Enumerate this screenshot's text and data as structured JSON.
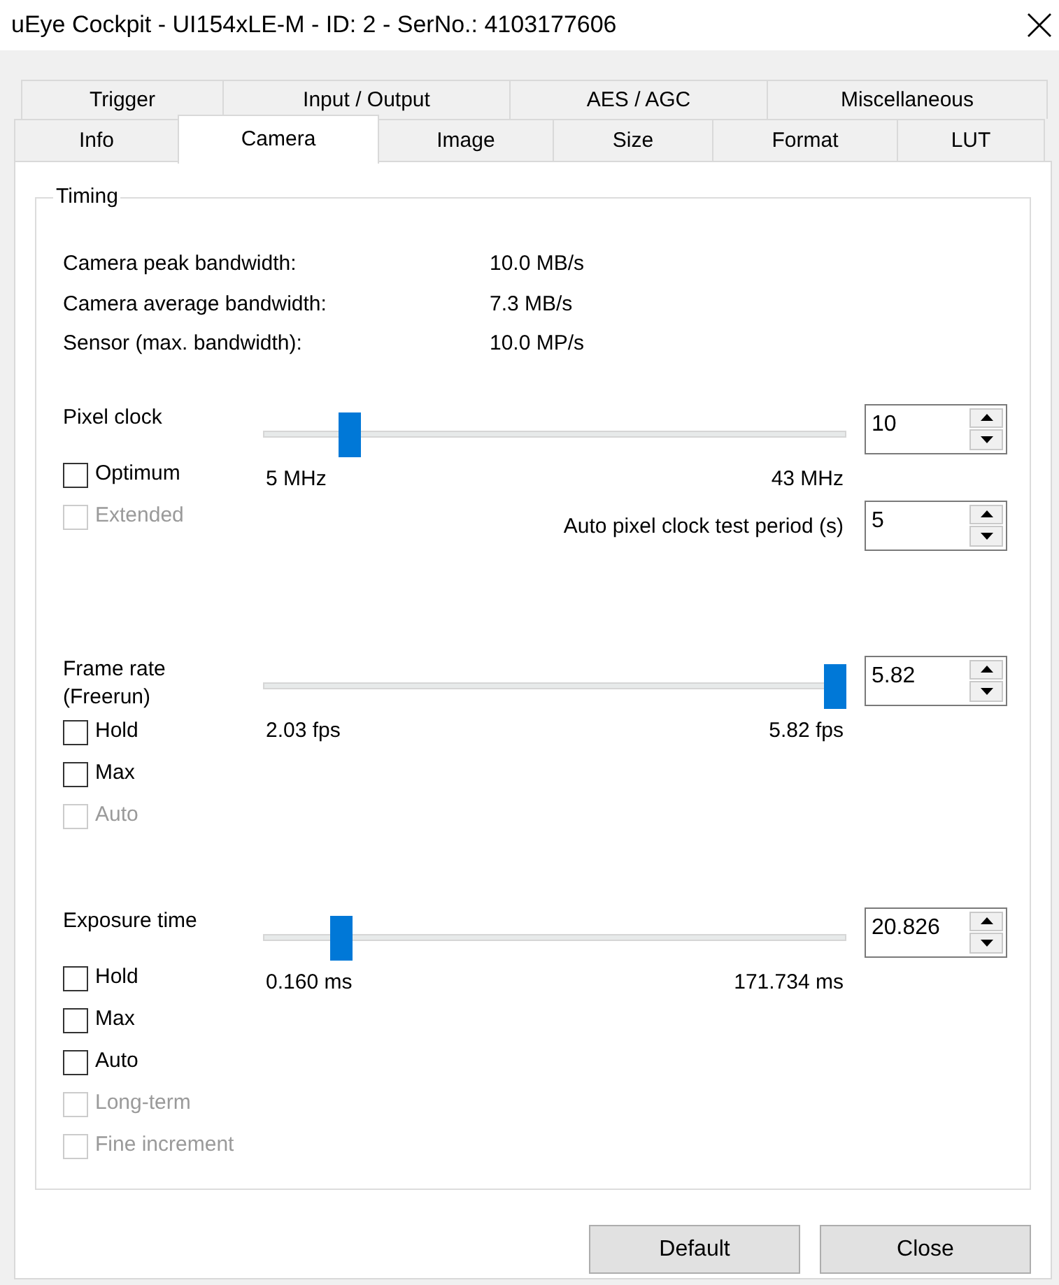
{
  "window": {
    "title": "uEye Cockpit - UI154xLE-M - ID: 2 - SerNo.: 4103177606"
  },
  "tab_rows": [
    [
      {
        "label": "Trigger",
        "selected": false
      },
      {
        "label": "Input / Output",
        "selected": false
      },
      {
        "label": "AES / AGC",
        "selected": false
      },
      {
        "label": "Miscellaneous",
        "selected": false
      }
    ],
    [
      {
        "label": "Info",
        "selected": false
      },
      {
        "label": "Camera",
        "selected": true
      },
      {
        "label": "Image",
        "selected": false
      },
      {
        "label": "Size",
        "selected": false
      },
      {
        "label": "Format",
        "selected": false
      },
      {
        "label": "LUT",
        "selected": false
      }
    ]
  ],
  "group": {
    "title": "Timing",
    "info": [
      {
        "label": "Camera peak bandwidth:",
        "value": "10.0 MB/s"
      },
      {
        "label": "Camera average bandwidth:",
        "value": "7.3 MB/s"
      },
      {
        "label": "Sensor (max. bandwidth):",
        "value": "10.0 MP/s"
      }
    ],
    "controls": [
      {
        "label": "Pixel clock",
        "level": 0.135,
        "min_label": "5 MHz",
        "max_label": "43 MHz",
        "value": "10",
        "checkboxes": [
          {
            "label": "Optimum",
            "checked": false,
            "disabled": false
          },
          {
            "label": "Extended",
            "checked": false,
            "disabled": true
          }
        ],
        "extra": {
          "label": "Auto pixel clock test period (s)",
          "value": "5"
        }
      },
      {
        "label": "Frame rate\n(Freerun)",
        "level": 1,
        "min_label": "2.03 fps",
        "max_label": "5.82 fps",
        "value": "5.82",
        "checkboxes": [
          {
            "label": "Hold",
            "checked": false,
            "disabled": false
          },
          {
            "label": "Max",
            "checked": false,
            "disabled": false
          },
          {
            "label": "Auto",
            "checked": false,
            "disabled": true
          }
        ]
      },
      {
        "label": "Exposure time",
        "level": 0.12,
        "min_label": "0.160 ms",
        "max_label": "171.734 ms",
        "value": "20.826",
        "checkboxes": [
          {
            "label": "Hold",
            "checked": false,
            "disabled": false
          },
          {
            "label": "Max",
            "checked": false,
            "disabled": false
          },
          {
            "label": "Auto",
            "checked": false,
            "disabled": false
          },
          {
            "label": "Long-term",
            "checked": false,
            "disabled": true
          },
          {
            "label": "Fine increment",
            "checked": false,
            "disabled": true
          }
        ]
      }
    ]
  },
  "buttons": [
    "Default",
    "Close"
  ]
}
